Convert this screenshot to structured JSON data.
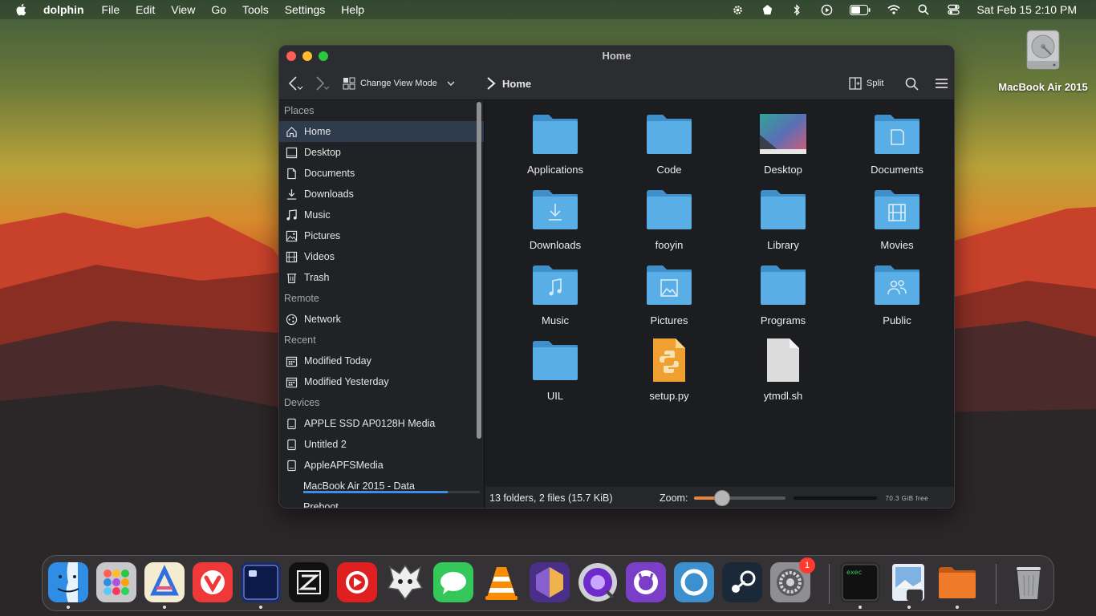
{
  "menubar": {
    "app": "dolphin",
    "items": [
      "File",
      "Edit",
      "View",
      "Go",
      "Tools",
      "Settings",
      "Help"
    ],
    "clock": "Sat Feb 15  2:10 PM",
    "status_icons": [
      "gear-icon",
      "app-menu-icon",
      "bluetooth-icon",
      "play-circle-icon",
      "battery-icon",
      "wifi-icon",
      "spotlight-search-icon",
      "control-center-icon"
    ]
  },
  "desktop": {
    "drive_label": "MacBook Air 2015"
  },
  "window": {
    "title": "Home",
    "toolbar": {
      "change_view": "Change View Mode",
      "breadcrumb": "Home",
      "split": "Split"
    },
    "sidebar": {
      "places_header": "Places",
      "places": [
        "Home",
        "Desktop",
        "Documents",
        "Downloads",
        "Music",
        "Pictures",
        "Videos",
        "Trash"
      ],
      "remote_header": "Remote",
      "remote": [
        "Network"
      ],
      "recent_header": "Recent",
      "recent": [
        "Modified Today",
        "Modified Yesterday"
      ],
      "devices_header": "Devices",
      "devices": [
        "APPLE SSD AP0128H Media",
        "Untitled 2",
        "AppleAPFSMedia",
        "MacBook Air 2015 - Data",
        "Preboot"
      ],
      "device_usage": 0.82
    },
    "files": [
      {
        "name": "Applications",
        "kind": "folder"
      },
      {
        "name": "Code",
        "kind": "folder"
      },
      {
        "name": "Desktop",
        "kind": "desktop"
      },
      {
        "name": "Documents",
        "kind": "folder-documents"
      },
      {
        "name": "Downloads",
        "kind": "folder-downloads"
      },
      {
        "name": "fooyin",
        "kind": "folder"
      },
      {
        "name": "Library",
        "kind": "folder"
      },
      {
        "name": "Movies",
        "kind": "folder-movies"
      },
      {
        "name": "Music",
        "kind": "folder-music"
      },
      {
        "name": "Pictures",
        "kind": "folder-pictures"
      },
      {
        "name": "Programs",
        "kind": "folder"
      },
      {
        "name": "Public",
        "kind": "folder-public"
      },
      {
        "name": "UIL",
        "kind": "folder"
      },
      {
        "name": "setup.py",
        "kind": "python"
      },
      {
        "name": "ytmdl.sh",
        "kind": "script"
      }
    ],
    "statusbar": {
      "summary": "13 folders, 2 files (15.7 KiB)",
      "zoom_label": "Zoom:",
      "zoom_level": 0.3,
      "free_space": "70.3 GiB free"
    }
  },
  "dock": {
    "apps": [
      "finder-icon",
      "launchpad-icon",
      "altstore-icon",
      "vivaldi-icon",
      "terminal-app-icon",
      "zed-icon",
      "youtube-music-icon",
      "kde-icon",
      "messages-icon",
      "vlc-icon",
      "affinity-icon",
      "quicktime-icon",
      "github-desktop-icon",
      "lens-icon",
      "steam-icon",
      "system-settings-icon",
      "exec-terminal-icon",
      "preview-icon",
      "folder-icon",
      "trash-icon"
    ],
    "settings_badge": "1"
  },
  "colors": {
    "folder": "#5aaee6",
    "folder_tab": "#3f8fca",
    "accent": "#3d8ee6",
    "zoom_fill": "#e8843d"
  }
}
